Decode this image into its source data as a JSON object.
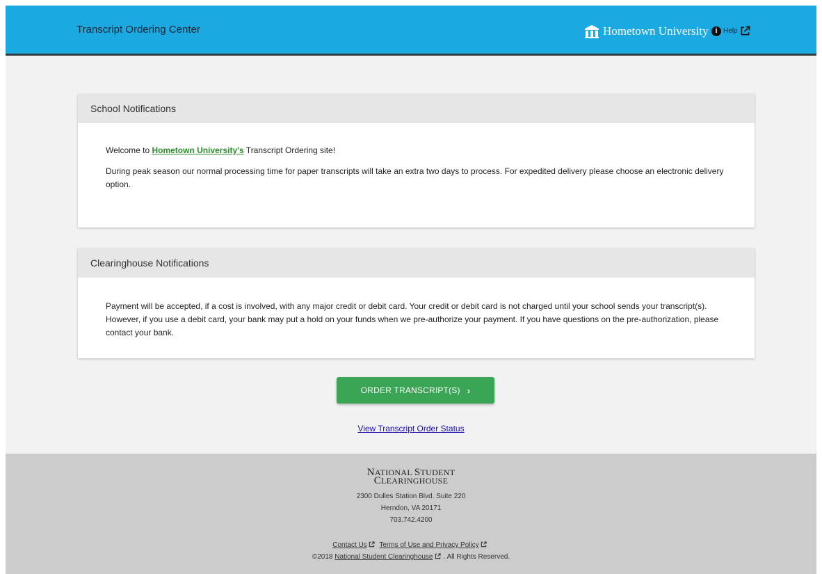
{
  "header": {
    "title": "Transcript Ordering Center",
    "brand_name": "Hometown University",
    "help_label": "Help"
  },
  "school_notifications": {
    "heading": "School Notifications",
    "welcome_prefix": "Welcome to ",
    "school_link": "Hometown University's",
    "welcome_suffix": " Transcript Ordering site!",
    "message": "During peak season our normal processing time for paper transcripts will take an extra two days to process. For expedited delivery please choose an electronic delivery option."
  },
  "clearinghouse_notifications": {
    "heading": "Clearinghouse Notifications",
    "message": "Payment will be accepted, if a cost is involved, with any major credit or debit card. Your credit or debit card is not charged until your school sends your transcript(s). However, if you use a debit card, your bank may put a hold on your funds when we pre-authorize your payment. If you have questions on the pre-authorization, please contact your bank."
  },
  "actions": {
    "order_button": "ORDER TRANSCRIPT(S)",
    "order_chevron": "›",
    "status_link": "View Transcript Order Status"
  },
  "footer": {
    "logo_line1_first": "N",
    "logo_line1_rest": "ATIONAL ",
    "logo_line1_first2": "S",
    "logo_line1_rest2": "TUDENT",
    "logo_line2_first": "C",
    "logo_line2_rest": "LEARINGHOUSE",
    "address_line1": "2300 Dulles Station Blvd. Suite 220",
    "address_line2": "Herndon, VA 20171",
    "phone": "703.742.4200",
    "contact_link": "Contact Us",
    "terms_link": "Terms of Use and Privacy Policy",
    "copyright_prefix": "©2018 ",
    "copyright_link": "National Student Clearinghouse",
    "copyright_suffix": ". All Rights Reserved."
  },
  "colors": {
    "header_bg": "#1ba9e1",
    "order_button_bg": "#3aa655",
    "school_link": "#2e8b2e",
    "page_bg": "#f2f2f2",
    "footer_bg": "#cccccc"
  },
  "icons": {
    "brand": "university-building-icon",
    "help": "info-circle-icon",
    "external": "external-link-icon"
  }
}
